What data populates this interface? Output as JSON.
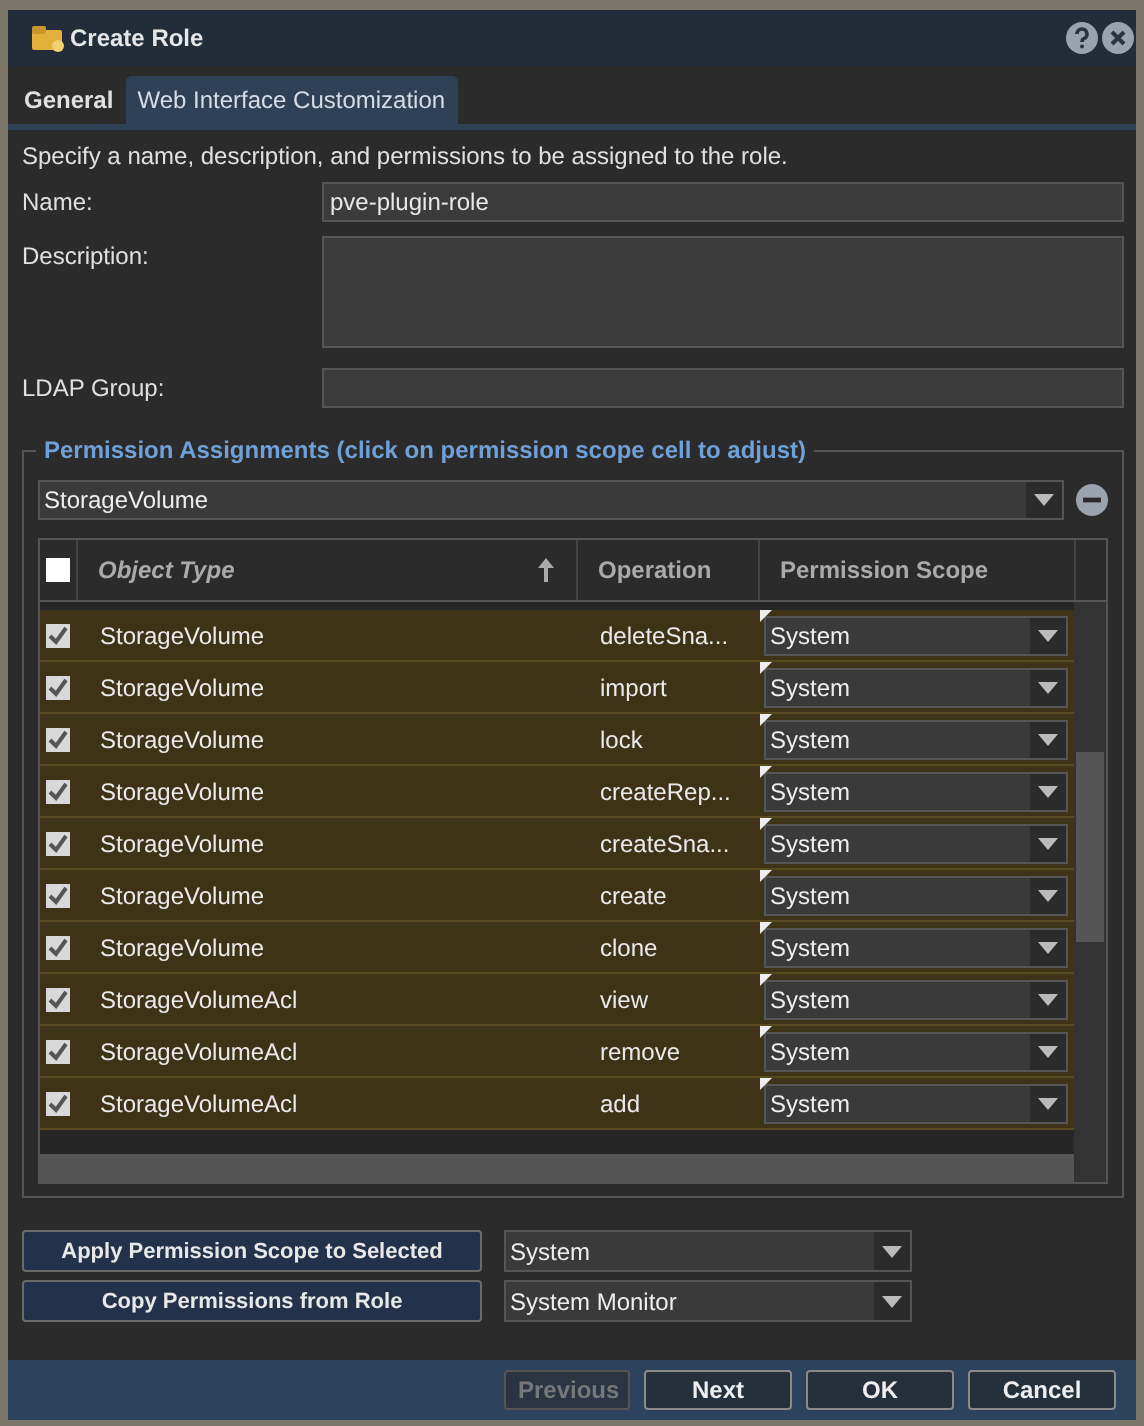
{
  "window": {
    "title": "Create Role"
  },
  "tabs": [
    {
      "label": "General",
      "selected": true
    },
    {
      "label": "Web Interface Customization",
      "selected": false
    }
  ],
  "intro": "Specify a name, description, and permissions to be assigned to the role.",
  "fields": [
    {
      "label": "Name:",
      "value": "pve-plugin-role",
      "kind": "text"
    },
    {
      "label": "Description:",
      "kind": "textarea"
    },
    {
      "label": "LDAP Group:",
      "kind": "text"
    }
  ],
  "permissions": {
    "legend": "Permission Assignments (click on permission scope cell to adjust)",
    "object_filter": "StorageVolume",
    "grid": {
      "all_checked": false,
      "columns": [
        {
          "label": "Object Type",
          "sorted": true
        },
        {
          "label": "Operation",
          "sorted": false
        },
        {
          "label": "Permission Scope",
          "sorted": false
        }
      ],
      "rows": [
        {
          "checked": true,
          "object_type": "StorageVolume",
          "operation": "deleteSna...",
          "scope": "System"
        },
        {
          "checked": true,
          "object_type": "StorageVolume",
          "operation": "import",
          "scope": "System"
        },
        {
          "checked": true,
          "object_type": "StorageVolume",
          "operation": "lock",
          "scope": "System"
        },
        {
          "checked": true,
          "object_type": "StorageVolume",
          "operation": "createRep...",
          "scope": "System"
        },
        {
          "checked": true,
          "object_type": "StorageVolume",
          "operation": "createSna...",
          "scope": "System"
        },
        {
          "checked": true,
          "object_type": "StorageVolume",
          "operation": "create",
          "scope": "System"
        },
        {
          "checked": true,
          "object_type": "StorageVolume",
          "operation": "clone",
          "scope": "System"
        },
        {
          "checked": true,
          "object_type": "StorageVolumeAcl",
          "operation": "view",
          "scope": "System"
        },
        {
          "checked": true,
          "object_type": "StorageVolumeAcl",
          "operation": "remove",
          "scope": "System"
        },
        {
          "checked": true,
          "object_type": "StorageVolumeAcl",
          "operation": "add",
          "scope": "System"
        }
      ]
    }
  },
  "actions": [
    {
      "label": "Apply Permission Scope to Selected",
      "value": "System"
    },
    {
      "label": "Copy Permissions from Role",
      "value": "System Monitor"
    }
  ],
  "buttons": [
    {
      "label": "Previous",
      "disabled": true
    },
    {
      "label": "Next",
      "disabled": false
    },
    {
      "label": "OK",
      "disabled": false
    },
    {
      "label": "Cancel",
      "disabled": false
    }
  ]
}
